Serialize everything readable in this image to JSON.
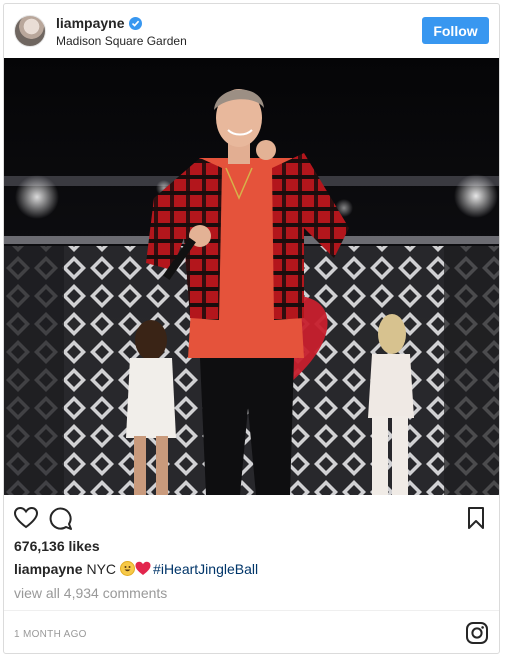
{
  "post": {
    "username": "liampayne",
    "verified": true,
    "location": "Madison Square Garden",
    "follow_label": "Follow",
    "likes": "676,136 likes",
    "caption": {
      "username": "liampayne",
      "text": "NYC",
      "hashtag": "#iHeartJingleBall"
    },
    "view_comments": "view all 4,934 comments",
    "timestamp": "1 MONTH AGO"
  },
  "colors": {
    "accent": "#3897f0",
    "text": "#262626",
    "muted": "#999999",
    "hashtag": "#003569"
  },
  "icons": [
    "heart-icon",
    "comment-icon",
    "bookmark-icon",
    "instagram-icon",
    "verified-badge-icon"
  ]
}
